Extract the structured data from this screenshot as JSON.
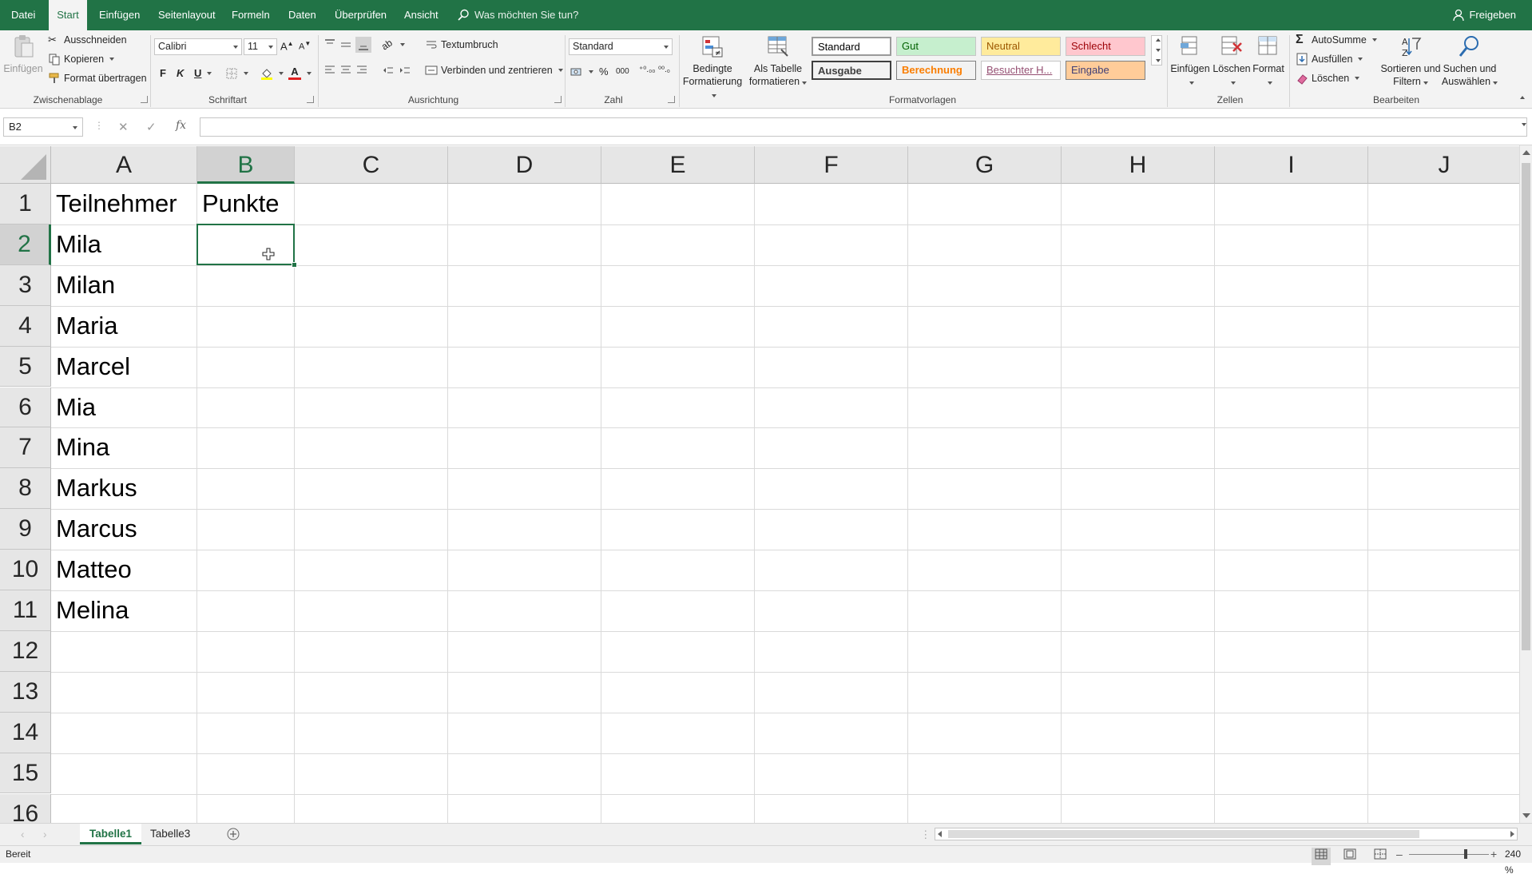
{
  "menubar": {
    "tabs": [
      "Datei",
      "Start",
      "Einfügen",
      "Seitenlayout",
      "Formeln",
      "Daten",
      "Überprüfen",
      "Ansicht"
    ],
    "active_tab": "Start",
    "tell_me": "Was möchten Sie tun?",
    "share": "Freigeben"
  },
  "ribbon": {
    "clipboard": {
      "paste": "Einfügen",
      "cut": "Ausschneiden",
      "copy": "Kopieren",
      "format_painter": "Format übertragen",
      "label": "Zwischenablage"
    },
    "font": {
      "name": "Calibri",
      "size": "11",
      "bold": "F",
      "italic": "K",
      "underline": "U",
      "label": "Schriftart"
    },
    "alignment": {
      "wrap": "Textumbruch",
      "merge": "Verbinden und zentrieren",
      "label": "Ausrichtung"
    },
    "number": {
      "format": "Standard",
      "percent": "%",
      "thousands": "000",
      "label": "Zahl"
    },
    "styles": {
      "conditional_line1": "Bedingte",
      "conditional_line2": "Formatierung",
      "astable_line1": "Als Tabelle",
      "astable_line2": "formatieren",
      "cells": [
        "Standard",
        "Gut",
        "Neutral",
        "Schlecht",
        "Ausgabe",
        "Berechnung",
        "Besuchter H...",
        "Eingabe"
      ],
      "label": "Formatvorlagen"
    },
    "cells_group": {
      "insert": "Einfügen",
      "delete": "Löschen",
      "format": "Format",
      "label": "Zellen"
    },
    "editing": {
      "autosum": "AutoSumme",
      "fill": "Ausfüllen",
      "clear": "Löschen",
      "sort_line1": "Sortieren und",
      "sort_line2": "Filtern",
      "find_line1": "Suchen und",
      "find_line2": "Auswählen",
      "label": "Bearbeiten"
    }
  },
  "formula_bar": {
    "name_box": "B2",
    "fx": "fx",
    "formula": ""
  },
  "grid": {
    "columns": [
      "A",
      "B",
      "C",
      "D",
      "E",
      "F",
      "G",
      "H",
      "I",
      "J"
    ],
    "rows": [
      "1",
      "2",
      "3",
      "4",
      "5",
      "6",
      "7",
      "8",
      "9",
      "10",
      "11",
      "12",
      "13",
      "14",
      "15",
      "16"
    ],
    "selected_cell": "B2",
    "cells": {
      "A1": "Teilnehmer",
      "B1": "Punkte",
      "A2": "Mila",
      "A3": "Milan",
      "A4": "Maria",
      "A5": "Marcel",
      "A6": "Mia",
      "A7": "Mina",
      "A8": "Markus",
      "A9": "Marcus",
      "A10": "Matteo",
      "A11": "Melina"
    }
  },
  "sheets": {
    "tabs": [
      "Tabelle1",
      "Tabelle3"
    ],
    "active": "Tabelle1"
  },
  "status": {
    "text": "Bereit",
    "zoom": "240 %"
  },
  "colors": {
    "accent": "#217346",
    "good_bg": "#c6efce",
    "neutral_bg": "#ffeb9c",
    "bad_bg": "#ffc7ce",
    "input_bg": "#ffcc99"
  }
}
